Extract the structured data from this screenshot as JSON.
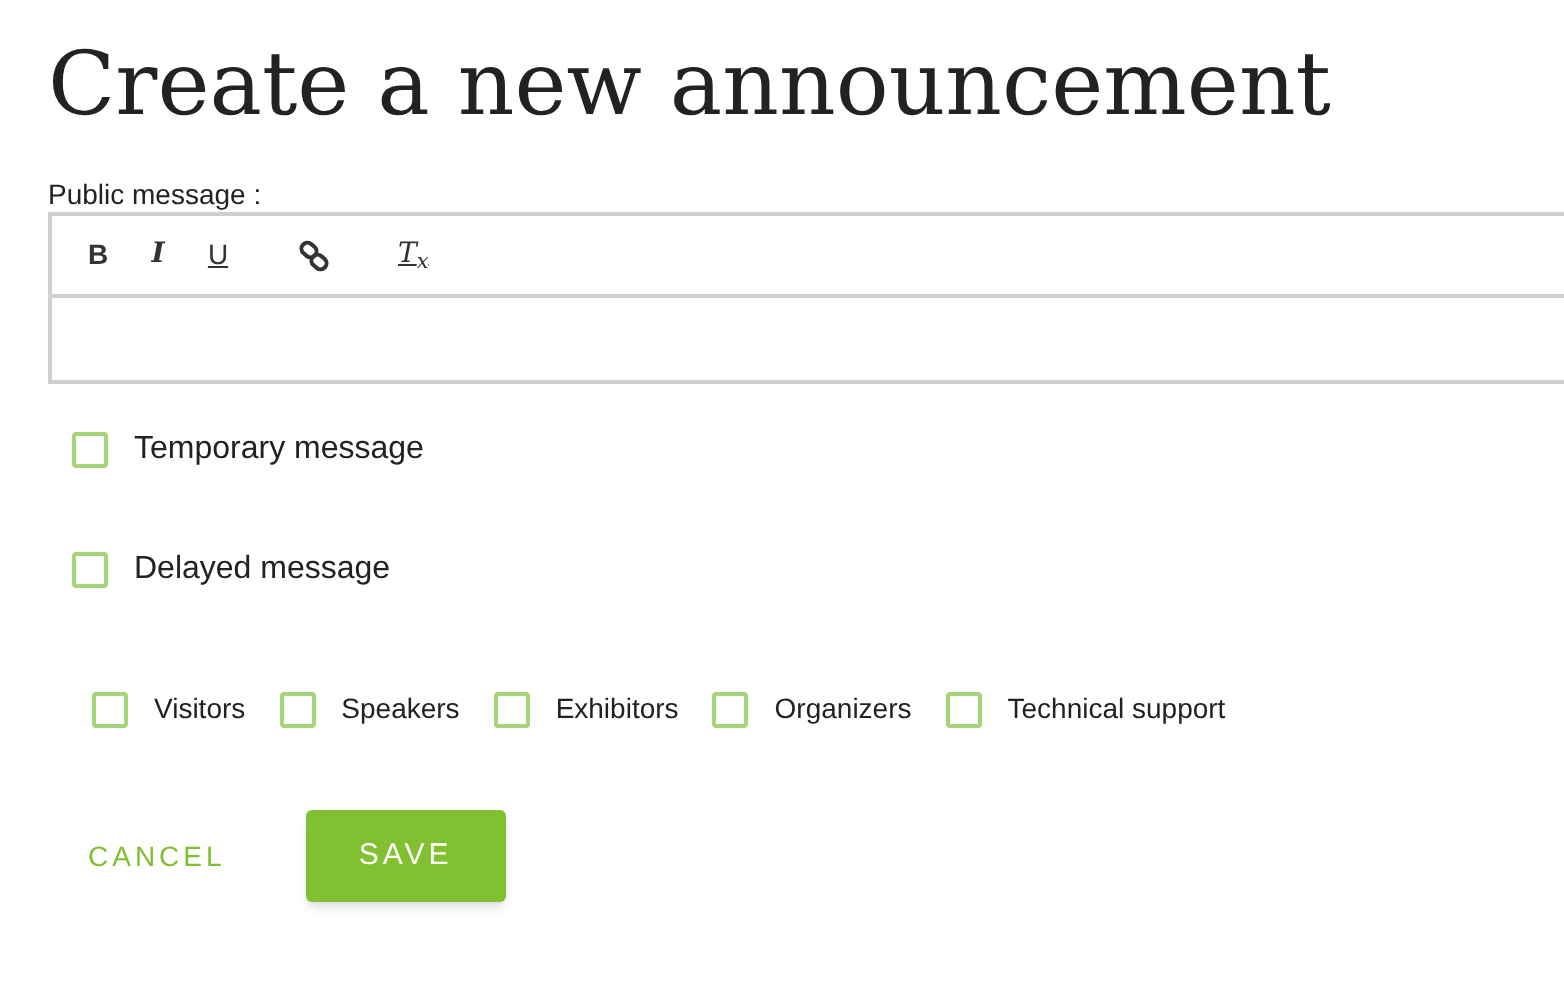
{
  "title": "Create a new announcement",
  "public_message": {
    "label": "Public message :",
    "toolbar": [
      {
        "kind": "bold",
        "label": "B"
      },
      {
        "kind": "italic",
        "label": "I"
      },
      {
        "kind": "underline",
        "label": "U"
      },
      {
        "kind": "link"
      },
      {
        "kind": "clear",
        "label": "T$_{x}$"
      }
    ]
  },
  "options": [
    {
      "label": "Temporary message",
      "checked": false
    },
    {
      "label": "Delayed message",
      "checked": false
    }
  ],
  "audiences": [
    {
      "label": "Visitors",
      "checked": false
    },
    {
      "label": "Speakers",
      "checked": false
    },
    {
      "label": "Exhibitors",
      "checked": false
    },
    {
      "label": "Organizers",
      "checked": false
    },
    {
      "label": "Technical support",
      "checked": false
    }
  ],
  "buttons": {
    "cancel": "CANCEL",
    "save": "SAVE"
  }
}
